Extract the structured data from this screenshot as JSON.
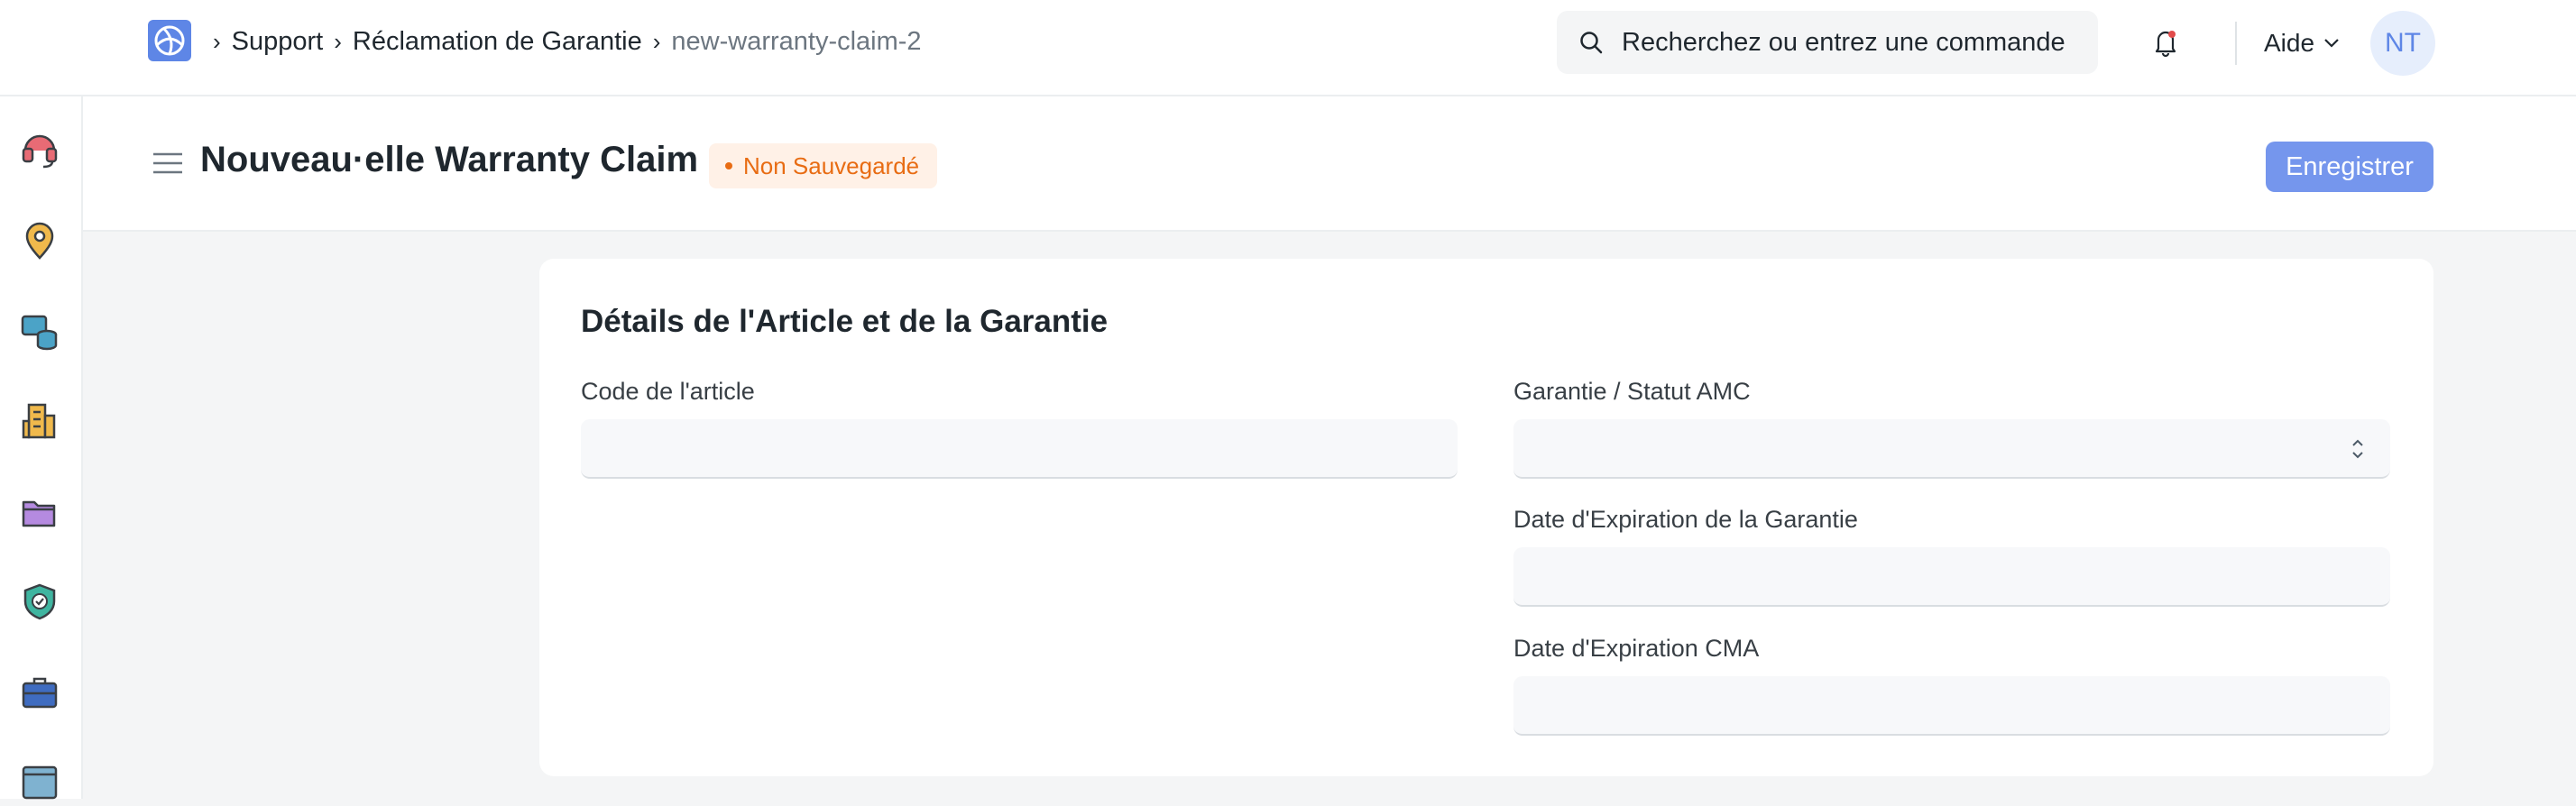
{
  "navbar": {
    "breadcrumbs": [
      "Support",
      "Réclamation de Garantie",
      "new-warranty-claim-2"
    ],
    "search_placeholder": "Recherchez ou entrez une commande",
    "help_label": "Aide",
    "avatar_initials": "NT"
  },
  "page": {
    "title": "Nouveau·elle Warranty Claim",
    "status_badge": "Non Sauvegardé",
    "save_label": "Enregistrer"
  },
  "form": {
    "section_title": "Détails de l'Article et de la Garantie",
    "fields": {
      "item_code": {
        "label": "Code de l'article",
        "value": ""
      },
      "warranty_status": {
        "label": "Garantie / Statut AMC",
        "value": ""
      },
      "warranty_expiry": {
        "label": "Date d'Expiration de la Garantie",
        "value": ""
      },
      "amc_expiry": {
        "label": "Date d'Expiration CMA",
        "value": ""
      }
    }
  },
  "colors": {
    "primary": "#7596ed",
    "badge_text": "#e86c13",
    "badge_bg": "#fff1e7"
  },
  "sidebar_icons": [
    "support-icon",
    "map-pin-icon",
    "database-icon",
    "building-icon",
    "folder-icon",
    "shield-check-icon",
    "briefcase-icon",
    "window-icon"
  ]
}
